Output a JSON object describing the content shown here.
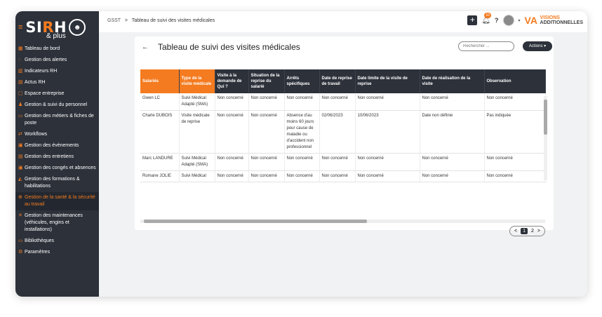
{
  "brand": {
    "name_a": "SI",
    "name_b": "R",
    "name_c": "H",
    "sub": "& plus"
  },
  "sidebar": {
    "items": [
      {
        "label": "Tableau de bord",
        "icon": "grid-icon",
        "glyph": "▦"
      },
      {
        "label": "Gestion des alertes",
        "icon": "bell-icon",
        "glyph": "◌"
      },
      {
        "label": "Indicateurs RH",
        "icon": "chart-icon",
        "glyph": "▥"
      },
      {
        "label": "Actus RH",
        "icon": "news-icon",
        "glyph": "▤"
      },
      {
        "label": "Espace entreprise",
        "icon": "building-icon",
        "glyph": "▢"
      },
      {
        "label": "Gestion & suivi du personnel",
        "icon": "users-icon",
        "glyph": "♟"
      },
      {
        "label": "Gestion des métiers & fiches de poste",
        "icon": "folder-icon",
        "glyph": "▭"
      },
      {
        "label": "Workflows",
        "icon": "workflow-icon",
        "glyph": "⇄"
      },
      {
        "label": "Gestion des évènements",
        "icon": "calendar-icon",
        "glyph": "▣"
      },
      {
        "label": "Gestion des entretiens",
        "icon": "interview-icon",
        "glyph": "▤"
      },
      {
        "label": "Gestion des congés et absences",
        "icon": "calendar-off-icon",
        "glyph": "▣"
      },
      {
        "label": "Gestion des formations & habilitations",
        "icon": "graduation-icon",
        "glyph": "◭"
      },
      {
        "label": "Gestion de la santé & la sécurité au travail",
        "icon": "health-icon",
        "glyph": "⊕"
      },
      {
        "label": "Gestion des maintenances (véhicules, engins et installations)",
        "icon": "tools-icon",
        "glyph": "✕"
      },
      {
        "label": "Bibliothèques",
        "icon": "library-icon",
        "glyph": "▭"
      },
      {
        "label": "Paramètres",
        "icon": "gear-icon",
        "glyph": "⚙"
      }
    ]
  },
  "breadcrumb": {
    "root": "GSST",
    "sep": ">",
    "current": "Tableau de suivi des visites médicales"
  },
  "topbar": {
    "notif_count": "10",
    "help": "?",
    "partner_line1": "VISIONS",
    "partner_line2": "ADDITIONNELLES"
  },
  "page": {
    "back": "←",
    "title": "Tableau de suivi des visites médicales",
    "search_placeholder": "Rechercher ...",
    "actions_label": "Actions ▾"
  },
  "table": {
    "headers": [
      "Salariés",
      "Type de la visite médicale",
      "Visite à la demande de Qui ?",
      "Situation de la reprise du salarié",
      "Arrêts spécifiques",
      "Date de reprise de travail",
      "Date limite de la visite de reprise",
      "Date de réalisation de la visite",
      "Observation"
    ],
    "rows": [
      [
        "Gwen LC",
        "Suivi Médical Adapté (SMA)",
        "Non concerné",
        "Non concerné",
        "Non concerné",
        "Non concerné",
        "Non concerné",
        "Non concerné",
        "Non concerné"
      ],
      [
        "Charle DUBOIS",
        "Visite médicale de reprise",
        "Non concerné",
        "Non concerné",
        "Absence d'au moins 60 jours pour cause de maladie ou d'accident non professionnel",
        "02/06/2023",
        "10/06/2023",
        "Date non définie",
        "Pas indiquée"
      ],
      [
        "Marc LANDURE",
        "Suivi Médical Adapté (SMA)",
        "Non concerné",
        "Non concerné",
        "Non concerné",
        "Non concerné",
        "Non concerné",
        "Non concerné",
        "Non concerné"
      ],
      [
        "Romane JOLIE",
        "Suivi Médical",
        "Non concerné",
        "Non concerné",
        "Non concerné",
        "Non concerné",
        "Non concerné",
        "Non concerné",
        "Non concerné"
      ]
    ]
  },
  "pagination": {
    "prev": "<",
    "page1": "1",
    "page2": "2",
    "next": ">"
  }
}
